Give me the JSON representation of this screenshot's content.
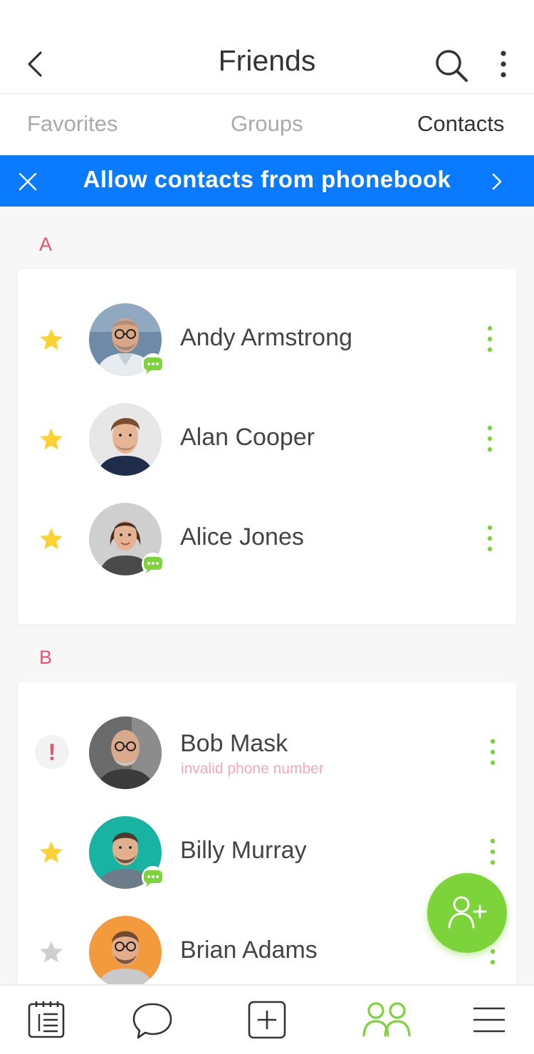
{
  "header": {
    "title": "Friends"
  },
  "tabs": [
    {
      "label": "Favorites",
      "active": false
    },
    {
      "label": "Groups",
      "active": false
    },
    {
      "label": "Contacts",
      "active": true
    }
  ],
  "banner": {
    "text": "Allow contacts from phonebook",
    "color": "#0a7bff"
  },
  "sections": [
    {
      "letter": "A",
      "contacts": [
        {
          "name": "Andy Armstrong",
          "status_icon": "star-filled",
          "has_message_badge": true
        },
        {
          "name": "Alan Cooper",
          "status_icon": "star-filled",
          "has_message_badge": false
        },
        {
          "name": "Alice Jones",
          "status_icon": "star-filled",
          "has_message_badge": true
        }
      ]
    },
    {
      "letter": "B",
      "contacts": [
        {
          "name": "Bob Mask",
          "subtitle": "invalid phone number",
          "status_icon": "warning",
          "has_message_badge": false
        },
        {
          "name": "Billy Murray",
          "status_icon": "star-filled",
          "has_message_badge": true
        },
        {
          "name": "Brian Adams",
          "status_icon": "star-empty",
          "has_message_badge": false
        }
      ]
    }
  ],
  "fab": {
    "icon": "add-user-icon"
  },
  "bottom_nav": [
    {
      "icon": "notebook-icon",
      "active": false
    },
    {
      "icon": "chat-bubble-icon",
      "active": false
    },
    {
      "icon": "plus-square-icon",
      "active": false
    },
    {
      "icon": "friends-icon",
      "active": true
    },
    {
      "icon": "menu-icon",
      "active": false
    }
  ],
  "colors": {
    "accent_green": "#7dd33a",
    "section_letter": "#f0506e",
    "star": "#fcd232",
    "star_empty": "#cfcfcf",
    "warning_subtitle": "#f6a9b8"
  }
}
